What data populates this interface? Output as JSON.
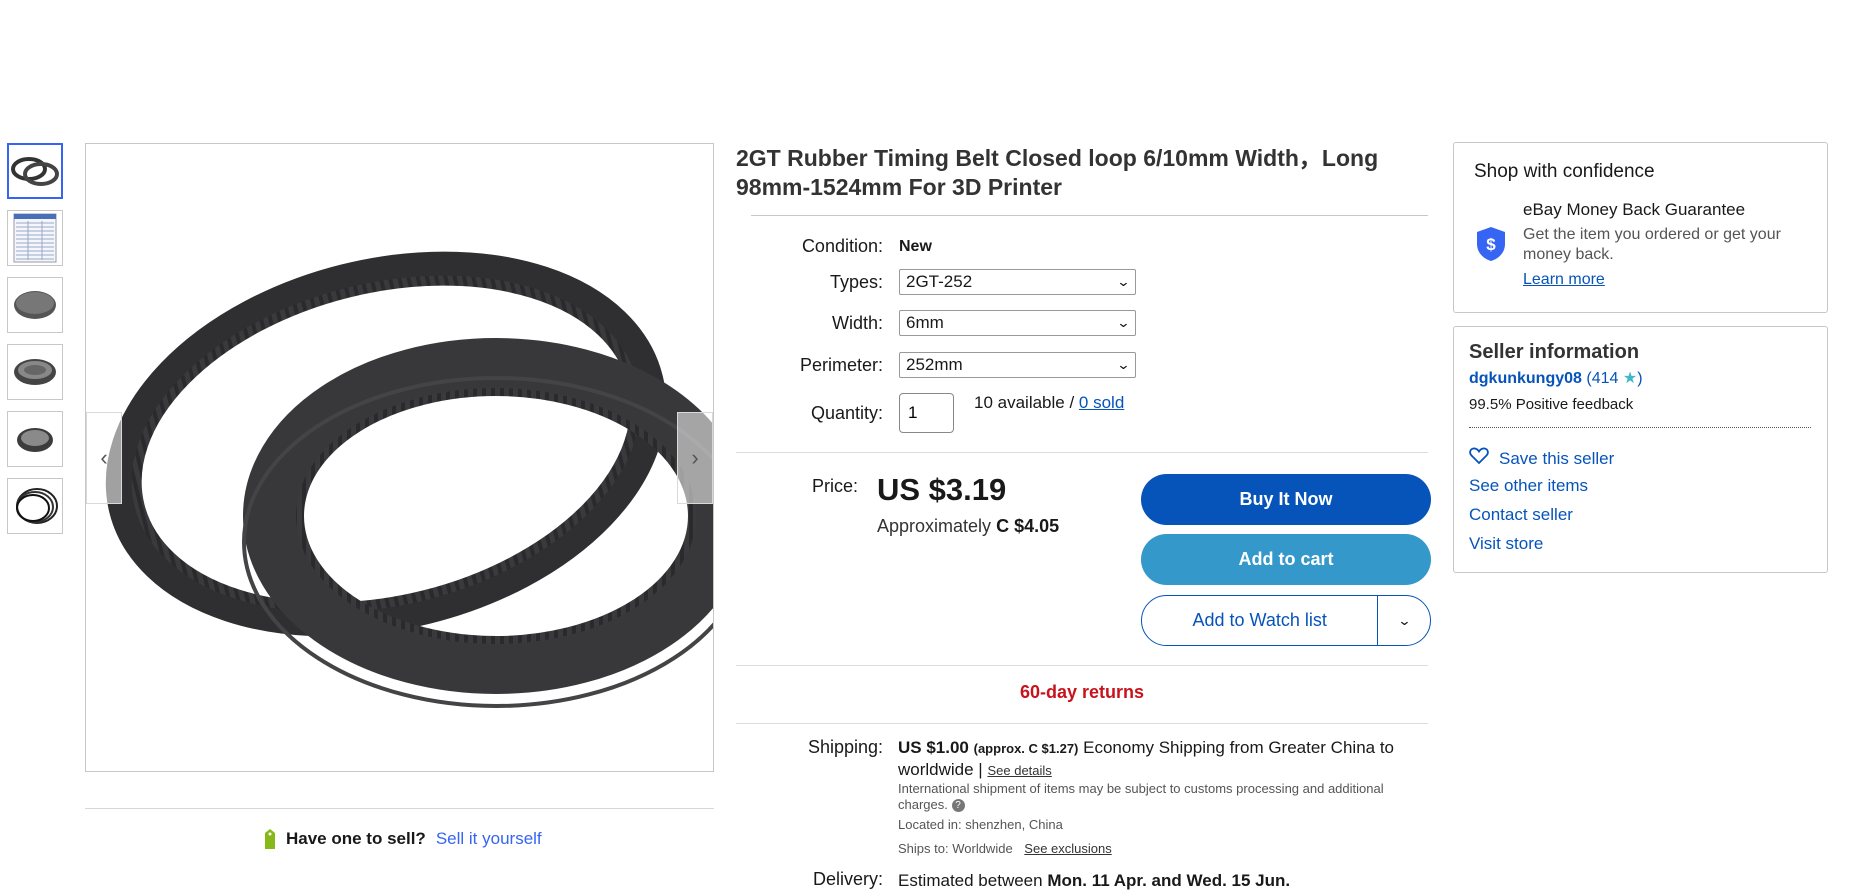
{
  "gallery": {
    "thumbnails": [
      "belt-pair",
      "size-table",
      "belt-disk-1",
      "belt-disk-2",
      "belt-disk-3",
      "belt-loops"
    ],
    "active_index": 0
  },
  "sell": {
    "question": "Have one to sell?",
    "link": "Sell it yourself"
  },
  "listing": {
    "title": "2GT Rubber Timing Belt Closed loop 6/10mm Width，Long 98mm-1524mm For 3D Printer",
    "condition_label": "Condition:",
    "condition_value": "New",
    "types_label": "Types:",
    "types_value": "2GT-252",
    "width_label": "Width:",
    "width_value": "6mm",
    "perimeter_label": "Perimeter:",
    "perimeter_value": "252mm",
    "quantity_label": "Quantity:",
    "quantity_value": "1",
    "available": "10 available /",
    "sold": "0 sold"
  },
  "price": {
    "label": "Price:",
    "value": "US $3.19",
    "approx_prefix": "Approximately",
    "approx_value": "C $4.05"
  },
  "buttons": {
    "buy_now": "Buy It Now",
    "add_to_cart": "Add to cart",
    "watch_list": "Add to Watch list"
  },
  "returns": "60-day returns",
  "shipping": {
    "label": "Shipping:",
    "cost": "US $1.00",
    "approx": "(approx. C $1.27)",
    "method": "Economy Shipping from Greater China to worldwide |",
    "see_details": "See details",
    "note": "International shipment of items may be subject to customs processing and additional charges.",
    "located_label": "Located in:",
    "located_value": "shenzhen, China",
    "ships_label": "Ships to:",
    "ships_value": "Worldwide",
    "exclusions": "See exclusions"
  },
  "delivery": {
    "label": "Delivery:",
    "prefix": "Estimated between",
    "dates": "Mon. 11 Apr. and Wed. 15 Jun."
  },
  "confidence": {
    "heading": "Shop with confidence",
    "guarantee_title": "eBay Money Back Guarantee",
    "guarantee_desc": "Get the item you ordered or get your money back.",
    "learn_more": "Learn more"
  },
  "seller": {
    "heading": "Seller information",
    "name": "dgkunkungy08",
    "open_paren": "(",
    "feedback_count": "414",
    "close_paren": ")",
    "positive": "99.5% Positive feedback",
    "save": "Save this seller",
    "other_items": "See other items",
    "contact": "Contact seller",
    "visit_store": "Visit store"
  },
  "colors": {
    "link_blue": "#0654ba",
    "cart_blue": "#3498ca",
    "returns_red": "#c7141c",
    "star_teal": "#40b8c8"
  },
  "icons": [
    "chevron-left-icon",
    "chevron-right-icon",
    "chevron-down-icon",
    "tag-icon",
    "shield-dollar-icon",
    "star-icon",
    "heart-icon",
    "help-icon"
  ]
}
